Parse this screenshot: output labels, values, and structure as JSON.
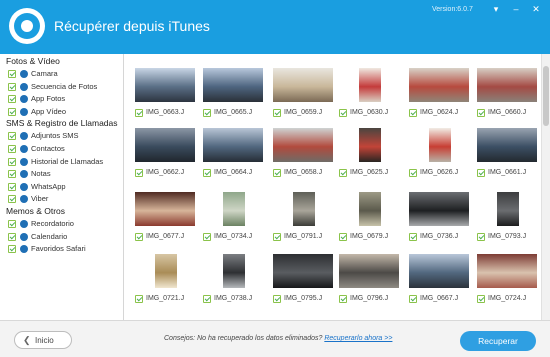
{
  "window": {
    "title": "Récupérer depuis iTunes",
    "version": "Version:6.0.7",
    "controls": [
      "▾",
      "–",
      "✕"
    ]
  },
  "sidebar": {
    "groups": [
      {
        "title": "Fotos & Vídeo",
        "items": [
          {
            "label": "Camara",
            "icon": "camera-icon"
          },
          {
            "label": "Secuencia de Fotos",
            "icon": "photo-stream-icon"
          },
          {
            "label": "App Fotos",
            "icon": "photos-app-icon"
          },
          {
            "label": "App Vídeo",
            "icon": "video-app-icon"
          }
        ]
      },
      {
        "title": "SMS & Registro de Llamadas",
        "items": [
          {
            "label": "Adjuntos SMS",
            "icon": "sms-attachment-icon"
          },
          {
            "label": "Contactos",
            "icon": "contacts-icon"
          },
          {
            "label": "Historial de Llamadas",
            "icon": "call-history-icon"
          },
          {
            "label": "Notas",
            "icon": "notes-icon"
          },
          {
            "label": "WhatsApp",
            "icon": "whatsapp-icon"
          },
          {
            "label": "Viber",
            "icon": "viber-icon"
          }
        ]
      },
      {
        "title": "Memos & Otros",
        "items": [
          {
            "label": "Recordatorio",
            "icon": "reminder-icon"
          },
          {
            "label": "Calendario",
            "icon": "calendar-icon"
          },
          {
            "label": "Favoridos Safari",
            "icon": "safari-bookmarks-icon"
          }
        ]
      }
    ]
  },
  "photos": [
    {
      "name": "IMG_0663.J",
      "kind": "land",
      "colors": [
        "#c9d6e6",
        "#5a6f86",
        "#2c3440"
      ]
    },
    {
      "name": "IMG_0665.J",
      "kind": "land",
      "colors": [
        "#b8c8dc",
        "#4e6580",
        "#2a3038"
      ]
    },
    {
      "name": "IMG_0659.J",
      "kind": "land",
      "colors": [
        "#e9e6df",
        "#c9b79a",
        "#7b6a55"
      ]
    },
    {
      "name": "IMG_0630.J",
      "kind": "port",
      "colors": [
        "#efe9e1",
        "#c43b3b",
        "#d9cfc2"
      ]
    },
    {
      "name": "IMG_0624.J",
      "kind": "land",
      "colors": [
        "#d8d2c8",
        "#b74a3e",
        "#8f8578"
      ]
    },
    {
      "name": "IMG_0660.J",
      "kind": "land",
      "colors": [
        "#d7cfc5",
        "#a44a44",
        "#8a8179"
      ]
    },
    {
      "name": "IMG_0662.J",
      "kind": "land",
      "colors": [
        "#8c97a6",
        "#3a4b5d",
        "#20262d"
      ]
    },
    {
      "name": "IMG_0664.J",
      "kind": "land",
      "colors": [
        "#b9c6d6",
        "#51677f",
        "#262d36"
      ]
    },
    {
      "name": "IMG_0658.J",
      "kind": "land",
      "colors": [
        "#cfd3d3",
        "#b24a3d",
        "#6f6c67"
      ]
    },
    {
      "name": "IMG_0625.J",
      "kind": "port",
      "colors": [
        "#4a4540",
        "#c24438",
        "#292522"
      ]
    },
    {
      "name": "IMG_0626.J",
      "kind": "port",
      "colors": [
        "#f1ede6",
        "#c73e33",
        "#b8b1a6"
      ]
    },
    {
      "name": "IMG_0661.J",
      "kind": "land",
      "colors": [
        "#9aa4b1",
        "#3c4f64",
        "#23292f"
      ]
    },
    {
      "name": "IMG_0677.J",
      "kind": "land",
      "colors": [
        "#4f2a22",
        "#d7b59a",
        "#8b3a2e"
      ]
    },
    {
      "name": "IMG_0734.J",
      "kind": "port",
      "colors": [
        "#8fa78a",
        "#cfd6c6",
        "#6b8262"
      ]
    },
    {
      "name": "IMG_0791.J",
      "kind": "port",
      "colors": [
        "#5e5f57",
        "#a9a59a",
        "#3b3c37"
      ]
    },
    {
      "name": "IMG_0679.J",
      "kind": "port",
      "colors": [
        "#9d9a86",
        "#5b5a4c",
        "#c7c2a9"
      ]
    },
    {
      "name": "IMG_0736.J",
      "kind": "land",
      "colors": [
        "#6b6e72",
        "#1e2022",
        "#a7a9ab"
      ]
    },
    {
      "name": "IMG_0793.J",
      "kind": "port",
      "colors": [
        "#3c3d3f",
        "#6b6d70",
        "#1c1d1e"
      ]
    },
    {
      "name": "IMG_0721.J",
      "kind": "port",
      "colors": [
        "#d7c6a4",
        "#a98c57",
        "#f0e6cf"
      ]
    },
    {
      "name": "IMG_0738.J",
      "kind": "port",
      "colors": [
        "#7c7f83",
        "#2e3033",
        "#b5b8bb"
      ]
    },
    {
      "name": "IMG_0795.J",
      "kind": "land",
      "colors": [
        "#2d2f32",
        "#5a5d61",
        "#17181a"
      ]
    },
    {
      "name": "IMG_0796.J",
      "kind": "land",
      "colors": [
        "#c3b8aa",
        "#4c4a47",
        "#8e8a83"
      ]
    },
    {
      "name": "IMG_0667.J",
      "kind": "land",
      "colors": [
        "#b9c7d9",
        "#52687f",
        "#2b323b"
      ]
    },
    {
      "name": "IMG_0724.J",
      "kind": "land",
      "colors": [
        "#7d3c35",
        "#d9c2ae",
        "#a65a4c"
      ]
    }
  ],
  "footer": {
    "back_label": "Inicio",
    "back_arrow": "❮",
    "tip_text": "Consejos: No ha recuperado los datos eliminados?",
    "tip_link": "Recuperarlo ahora >>",
    "recover_label": "Recuperar"
  }
}
